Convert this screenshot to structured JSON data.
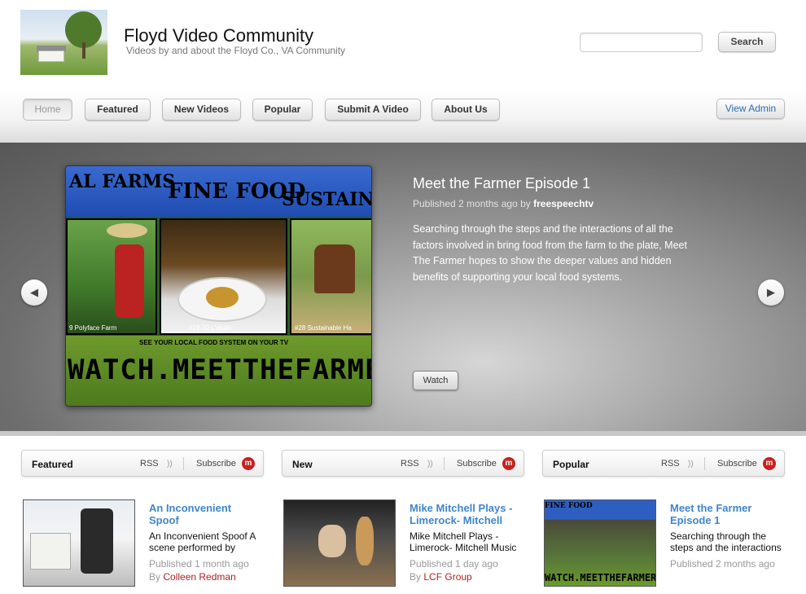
{
  "header": {
    "title": "Floyd Video Community",
    "subtitle": "Videos by and about the Floyd Co., VA Community",
    "search_placeholder": "",
    "search_button": "Search"
  },
  "nav": {
    "items": [
      "Home",
      "Featured",
      "New Videos",
      "Popular",
      "Submit A Video",
      "About Us"
    ],
    "active": "Home",
    "admin_label": "View Admin"
  },
  "hero": {
    "title": "Meet the Farmer Episode 1",
    "published_prefix": "Published 2 months ago by",
    "author": "freespeechtv",
    "description": "Searching through the steps and the interactions of all the factors involved in bring food from the farm to the plate, Meet The Farmer hopes to show the deeper values and hidden benefits of supporting your local food systems.",
    "watch_label": "Watch",
    "prev_icon": "chevron-left-icon",
    "next_icon": "chevron-right-icon",
    "image_text": {
      "top_left": "AL FARMS",
      "top_mid": "FINE FOOD",
      "top_right": "SUSTAINA",
      "cap1": "9 Polyface Farm",
      "cap2": "#19-20 L'etoile",
      "cap3": "#28 Sustainable Ha",
      "small": "SEE YOUR LOCAL FOOD SYSTEM ON YOUR TV",
      "big": "WATCH.MEETTHEFARMER.T"
    }
  },
  "panels": [
    {
      "title": "Featured",
      "rss": "RSS",
      "subscribe": "Subscribe",
      "video": {
        "title": "An Inconvenient Spoof",
        "description": "An Inconvenient Spoof A scene performed by",
        "published": "Published 1 month ago",
        "by": "By",
        "author": "Colleen Redman"
      }
    },
    {
      "title": "New",
      "rss": "RSS",
      "subscribe": "Subscribe",
      "video": {
        "title": "Mike Mitchell Plays -Limerock- Mitchell",
        "description": "Mike Mitchell Plays -Limerock- Mitchell Music",
        "published": "Published 1 day ago",
        "by": "By",
        "author": "LCF Group"
      }
    },
    {
      "title": "Popular",
      "rss": "RSS",
      "subscribe": "Subscribe",
      "video": {
        "title": "Meet the Farmer Episode 1",
        "description": "Searching through the steps and the interactions",
        "published": "Published 2 months ago",
        "by": "",
        "author": ""
      }
    }
  ],
  "colors": {
    "link_blue": "#3f86cf",
    "author_red": "#b02222",
    "subscribe_badge": "#c8201e"
  }
}
